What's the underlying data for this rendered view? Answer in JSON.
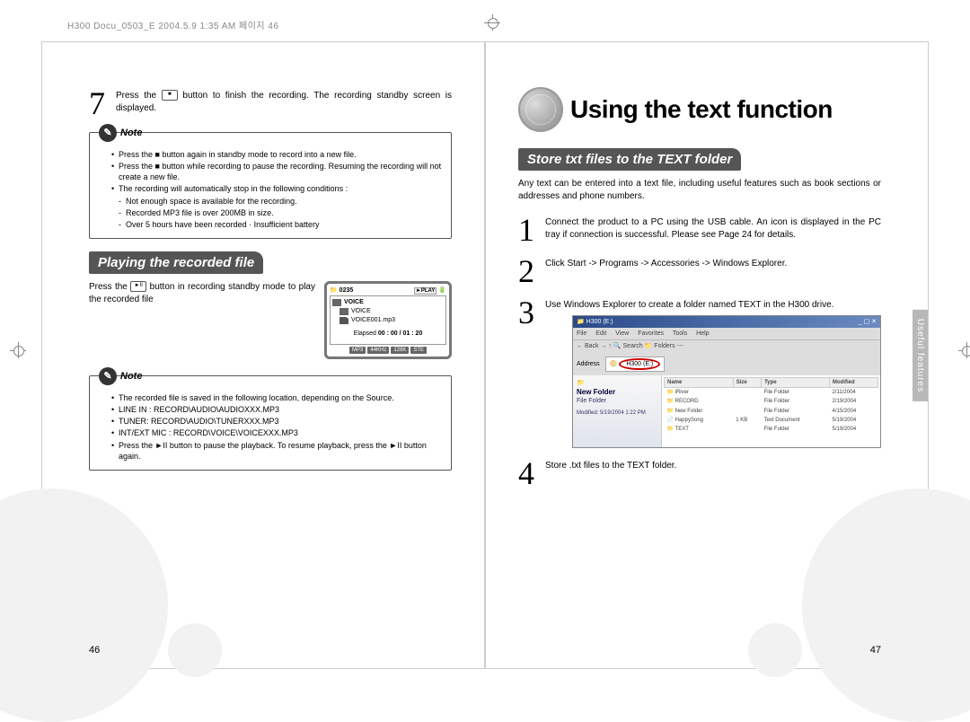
{
  "print_header": "H300 Docu_0503_E 2004.5.9 1:35 AM 페이지 46",
  "left_page": {
    "step7": {
      "num": "7",
      "text_before": "Press the ",
      "text_after": " button to finish the recording. The recording standby screen is displayed."
    },
    "note1": {
      "label": "Note",
      "items": [
        "Press the  ■  button again in standby mode to record into a new file.",
        "Press the  ■  button while recording to pause the recording. Resuming the recording will not create a new file.",
        "The recording will automatically stop in the following conditions :",
        "Not enough space is available for the recording.",
        "Recorded MP3 file is over 200MB in size.",
        "Over 5 hours have been recorded    · Insufficient battery"
      ]
    },
    "section": "Playing the recorded file",
    "play_text_before": "Press the ",
    "play_text_after": " button in recording standby mode to play the recorded file",
    "screen": {
      "time": "0235",
      "play_badge": "►PLAY",
      "folder": "VOICE",
      "sub_folder": "VOICE",
      "file": "VOICE001.mp3",
      "elapsed_label": "Elapsed",
      "elapsed": "00 : 00 / 01 : 20",
      "badges": [
        "MP3",
        "44KHz",
        "128K",
        "STE"
      ]
    },
    "note2": {
      "label": "Note",
      "items": [
        "The recorded file is saved in the following location, depending on the Source.",
        "LINE IN : RECORD\\AUDIO\\AUDIOXXX.MP3",
        "TUNER: RECORD\\AUDIO\\TUNERXXX.MP3",
        "INT/EXT MIC : RECORD\\VOICE\\VOICEXXX.MP3",
        "Press the  ►II  button to pause the playback. To resume playback, press the  ►II  button again."
      ]
    },
    "page_num": "46"
  },
  "right_page": {
    "title": "Using the text function",
    "section": "Store txt files to the TEXT folder",
    "intro": "Any text can be entered into a text file, including useful features such as book sections or addresses and phone numbers.",
    "steps": {
      "1": "Connect the product to a PC using the USB cable. An icon is displayed in the PC tray if connection is successful.\nPlease see Page 24 for details.",
      "2": "Click Start -> Programs -> Accessories -> Windows Explorer.",
      "3": "Use Windows Explorer to create a folder named TEXT in the H300 drive.",
      "4": "Store .txt files to the TEXT folder."
    },
    "explorer": {
      "title": "H300 (E:)",
      "menus": [
        "File",
        "Edit",
        "View",
        "Favorites",
        "Tools",
        "Help"
      ],
      "toolbar": "← Back  →  ↑  🔍 Search  📁 Folders  ⋯",
      "address_label": "Address",
      "address": "H300 (E:)",
      "side_title": "New Folder",
      "side_sub": "File Folder",
      "side_mod": "Modified: 5/19/2004 1:22 PM",
      "cols": [
        "Name",
        "Size",
        "Type",
        "Modified"
      ],
      "rows": [
        [
          "iRiver",
          "",
          "File Folder",
          "2/11/2004"
        ],
        [
          "RECORD",
          "",
          "File Folder",
          "2/19/2004"
        ],
        [
          "New Folder",
          "",
          "File Folder",
          "4/15/2004"
        ],
        [
          "HappySong",
          "1 KB",
          "Text Document",
          "5/19/2004"
        ],
        [
          "TEXT",
          "",
          "File Folder",
          "5/19/2004"
        ]
      ]
    },
    "side_tab": "Useful features",
    "page_num": "47"
  }
}
